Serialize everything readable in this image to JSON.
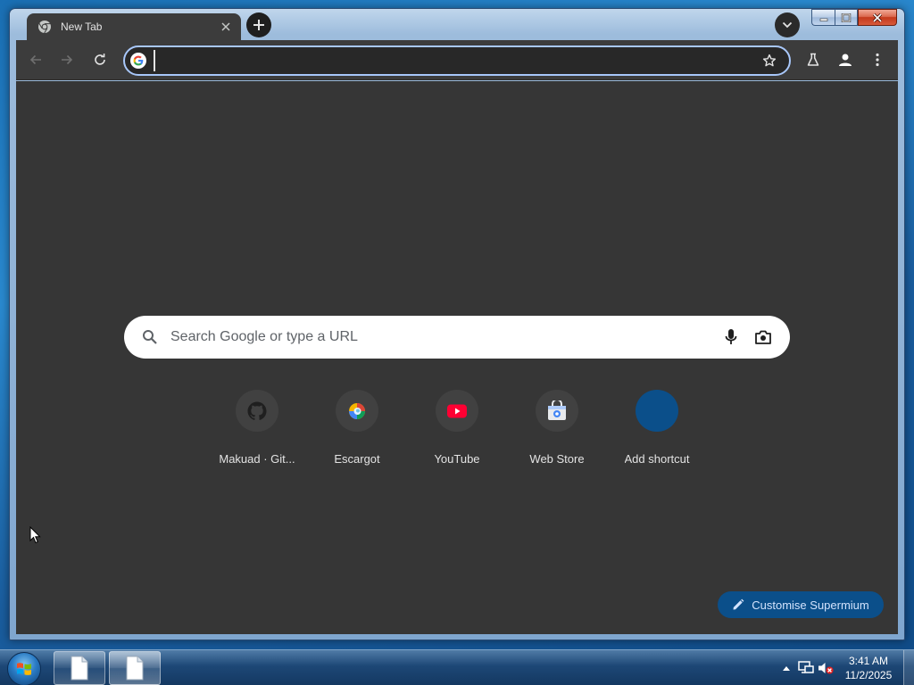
{
  "browser": {
    "tab": {
      "title": "New Tab",
      "favicon": "chromium-icon",
      "close_icon": "close-icon"
    },
    "new_tab_icon": "plus-icon",
    "tab_search_icon": "chevron-down-icon",
    "toolbar": {
      "back_icon": "arrow-left-icon",
      "forward_icon": "arrow-right-icon",
      "reload_icon": "reload-icon",
      "omnibox": {
        "value": "",
        "placeholder": "",
        "provider_icon": "google-g-icon",
        "bookmark_icon": "star-icon"
      },
      "labs_icon": "flask-icon",
      "profile_icon": "person-icon",
      "menu_icon": "kebab-menu-icon"
    },
    "accent_color": "#a8c7fa"
  },
  "ntp": {
    "search": {
      "placeholder": "Search Google or type a URL",
      "search_icon": "search-icon",
      "voice_icon": "mic-icon",
      "lens_icon": "camera-icon"
    },
    "shortcuts": [
      {
        "label": "Makuad · Git...",
        "icon": "github-icon"
      },
      {
        "label": "Escargot",
        "icon": "escargot-icon"
      },
      {
        "label": "YouTube",
        "icon": "youtube-icon"
      },
      {
        "label": "Web Store",
        "icon": "web-store-icon"
      },
      {
        "label": "Add shortcut",
        "icon": "add-shortcut-icon"
      }
    ],
    "customise_label": "Customise Supermium",
    "background_color": "#363636"
  },
  "taskbar": {
    "start_icon": "windows-logo-icon",
    "pinned": [
      {
        "icon": "document-icon"
      },
      {
        "icon": "document-icon",
        "active": true
      }
    ],
    "tray": {
      "icons": [
        "show-hidden-icons",
        "network-icon",
        "volume-muted-icon"
      ],
      "time": "3:41 AM",
      "date": "11/2/2025"
    }
  }
}
